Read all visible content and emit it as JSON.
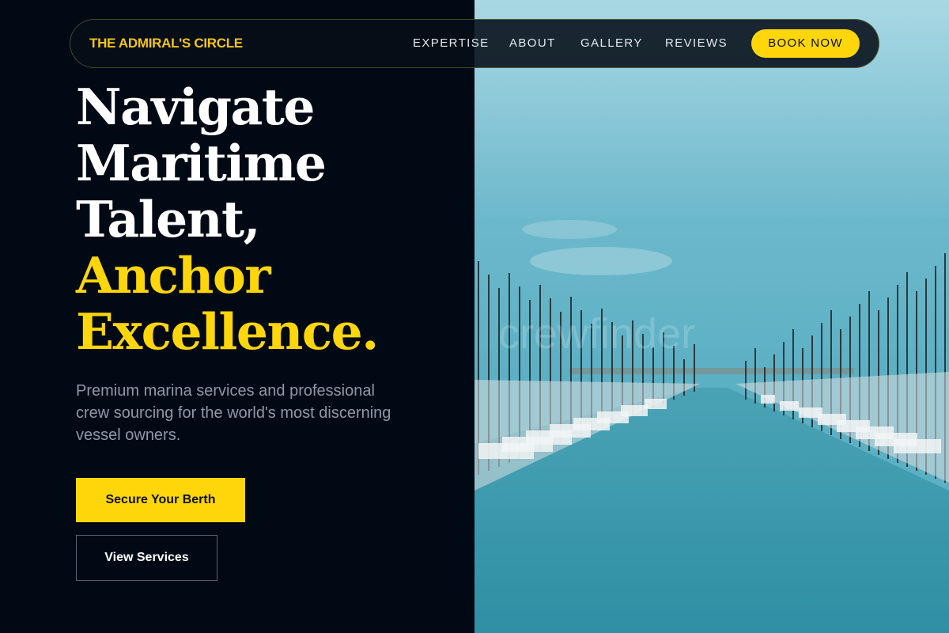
{
  "nav": {
    "brand": "THE ADMIRAL'S CIRCLE",
    "links": [
      "EXPERTISE",
      "ABOUT",
      "GALLERY",
      "REVIEWS"
    ],
    "cta": "BOOK NOW"
  },
  "hero": {
    "headline_white": [
      "Navigate",
      "Maritime",
      "Talent,"
    ],
    "headline_yellow": [
      "Anchor",
      "Excellence."
    ],
    "subtitle": "Premium marina services and professional crew sourcing for the world's most discerning vessel owners.",
    "primary_button": "Secure Your Berth",
    "secondary_button": "View Services"
  },
  "photo": {
    "watermark": "crewfinder"
  },
  "colors": {
    "background": "#010a14",
    "accent": "#ffd60a",
    "muted_text": "#8f98a6"
  }
}
